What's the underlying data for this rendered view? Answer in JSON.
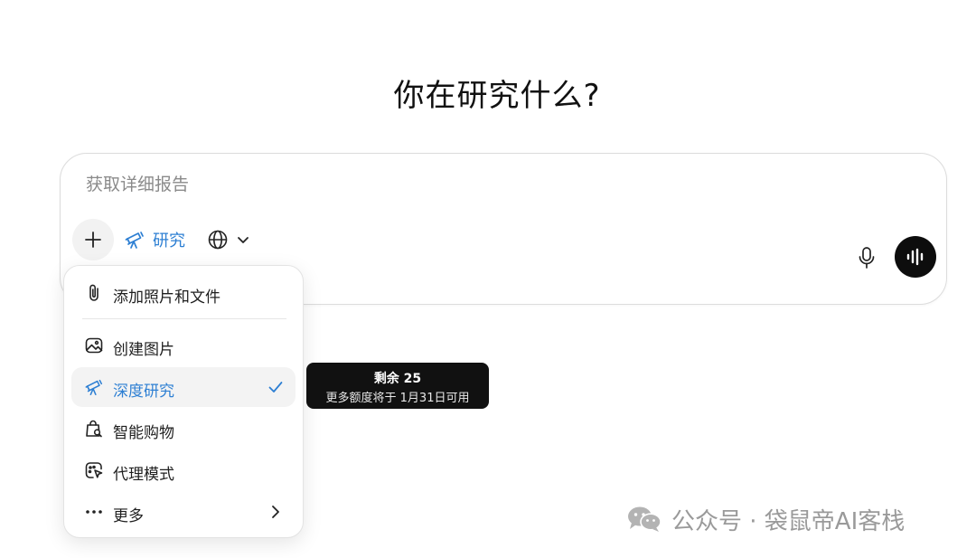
{
  "page": {
    "title": "你在研究什么?"
  },
  "composer": {
    "placeholder": "获取详细报告",
    "research_label": "研究"
  },
  "menu": {
    "items": [
      {
        "label": "添加照片和文件",
        "icon": "paperclip-icon"
      },
      {
        "label": "创建图片",
        "icon": "image-icon"
      },
      {
        "label": "深度研究",
        "icon": "telescope-icon",
        "selected": true
      },
      {
        "label": "智能购物",
        "icon": "shopping-bag-icon"
      },
      {
        "label": "代理模式",
        "icon": "agent-cursor-icon"
      },
      {
        "label": "更多",
        "icon": "more-dots-icon"
      }
    ]
  },
  "tooltip": {
    "line1": "剩余 25",
    "line2": "更多额度将于 1月31日可用"
  },
  "watermark": {
    "text": "公众号 · 袋鼠帝AI客栈"
  },
  "colors": {
    "accent": "#2d7fd3",
    "dark": "#0d0d0d"
  }
}
